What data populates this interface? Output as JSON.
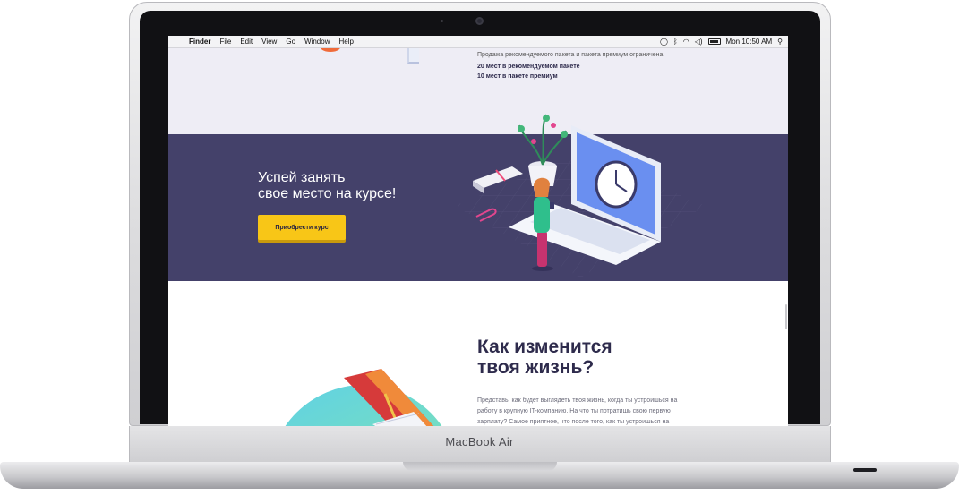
{
  "device": {
    "model_label": "MacBook Air"
  },
  "menubar": {
    "apple_icon": "apple-icon",
    "items": [
      "Finder",
      "File",
      "Edit",
      "View",
      "Go",
      "Window",
      "Help"
    ],
    "clock": "Mon 10:50 AM",
    "status_icons": [
      "chat-icon",
      "bluetooth-icon",
      "wifi-icon",
      "volume-icon",
      "battery-icon",
      "search-icon"
    ]
  },
  "seats": {
    "note": "Продажа рекомендуемого пакета и пакета премиум ограничена:",
    "recommended": "20 мест в рекомендуемом пакете",
    "premium": "10 мест в пакете премиум"
  },
  "cta": {
    "heading_line1": "Успей занять",
    "heading_line2": "свое место на курсе!",
    "button_label": "Приобрести курс"
  },
  "life": {
    "heading_line1": "Как изменится",
    "heading_line2": "твоя жизнь?",
    "paragraph": "Представь, как будет выглядеть твоя жизнь, когда ты устроишься на работу в крупную IT-компанию. На что ты потратишь свою первую зарплату? Самое приятное, что после того, как ты устроишься на"
  },
  "colors": {
    "cta_background": "#44416a",
    "button_yellow": "#f8c617",
    "heading_dark": "#2e2b4c",
    "top_section_background": "#eeedf5"
  }
}
